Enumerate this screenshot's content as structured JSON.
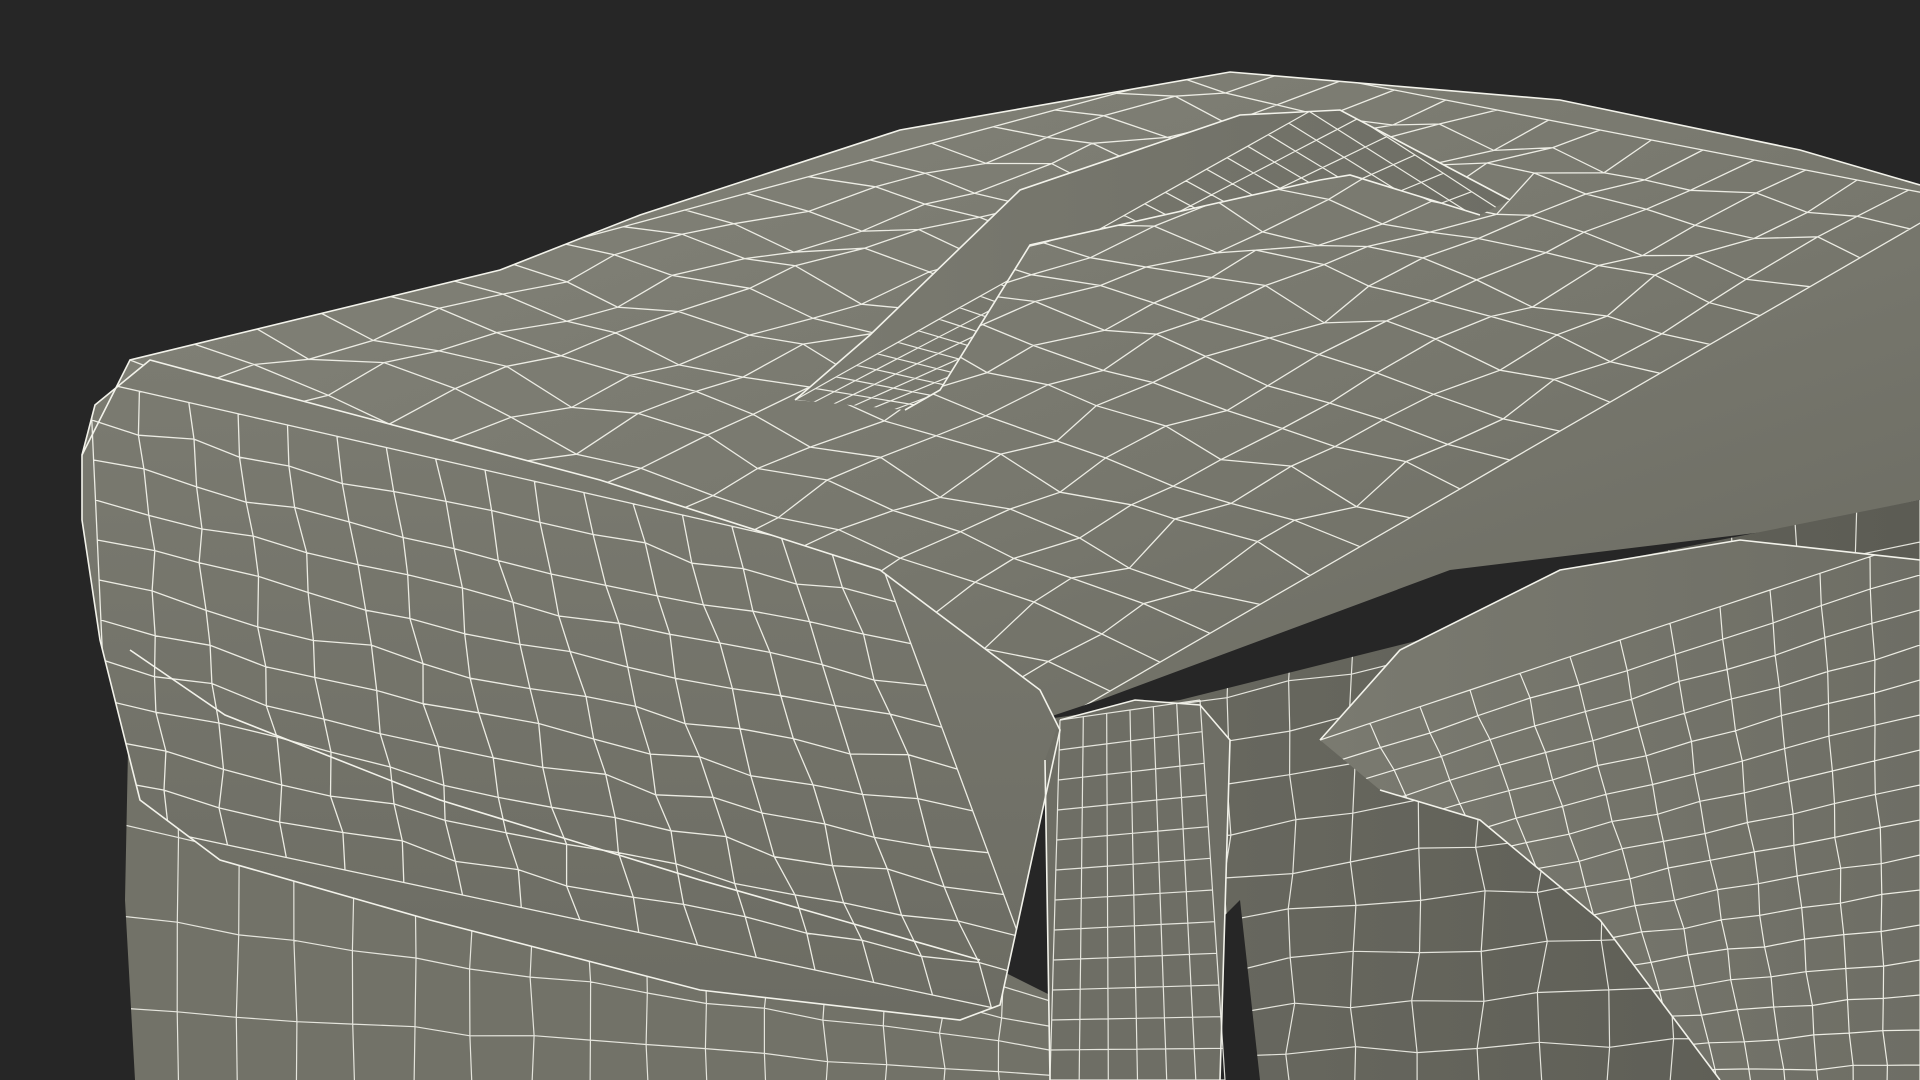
{
  "scene": {
    "subject": "wireframe-backpack-render",
    "colors": {
      "background": "#262626",
      "surface_light": "#7d7d72",
      "surface_mid": "#727268",
      "surface_dark": "#5e5e55",
      "wire": "#f2f2ea"
    }
  }
}
